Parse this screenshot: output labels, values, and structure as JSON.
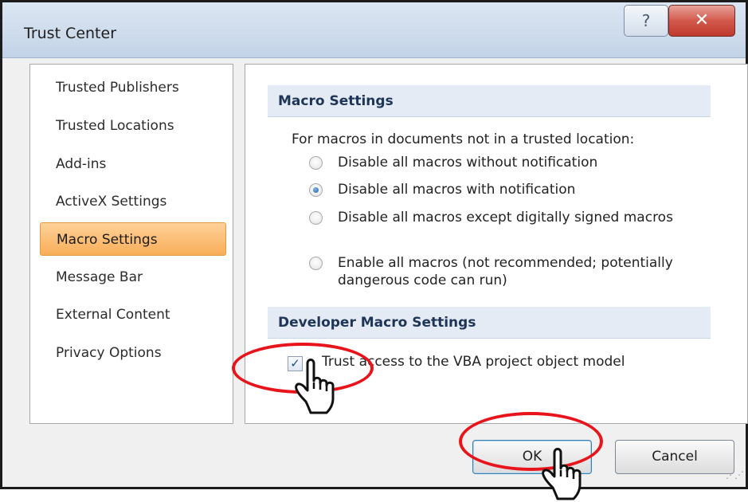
{
  "window": {
    "title": "Trust Center",
    "help_label": "?",
    "close_label": "✕"
  },
  "sidebar": {
    "items": [
      {
        "label": "Trusted Publishers",
        "active": false
      },
      {
        "label": "Trusted Locations",
        "active": false
      },
      {
        "label": "Add-ins",
        "active": false
      },
      {
        "label": "ActiveX Settings",
        "active": false
      },
      {
        "label": "Macro Settings",
        "active": true
      },
      {
        "label": "Message Bar",
        "active": false
      },
      {
        "label": "External Content",
        "active": false
      },
      {
        "label": "Privacy Options",
        "active": false
      }
    ]
  },
  "macro_settings": {
    "header": "Macro Settings",
    "intro": "For macros in documents not in a trusted location:",
    "options": [
      {
        "label": "Disable all macros without notification",
        "selected": false
      },
      {
        "label": "Disable all macros with notification",
        "selected": true
      },
      {
        "label": "Disable all macros except digitally signed macros",
        "selected": false
      },
      {
        "label": "Enable all macros (not recommended; potentially dangerous code can run)",
        "selected": false
      }
    ]
  },
  "developer_settings": {
    "header": "Developer Macro Settings",
    "trust_vba_label": "Trust access to the VBA project object model",
    "trust_vba_checked": true,
    "check_mark": "✓"
  },
  "footer": {
    "ok_label": "OK",
    "cancel_label": "Cancel",
    "grip": "⋰⋰"
  },
  "annotations": {
    "highlight_color": "#e8141b",
    "icons": [
      "pointer-hand-icon",
      "pointer-hand-icon"
    ]
  }
}
